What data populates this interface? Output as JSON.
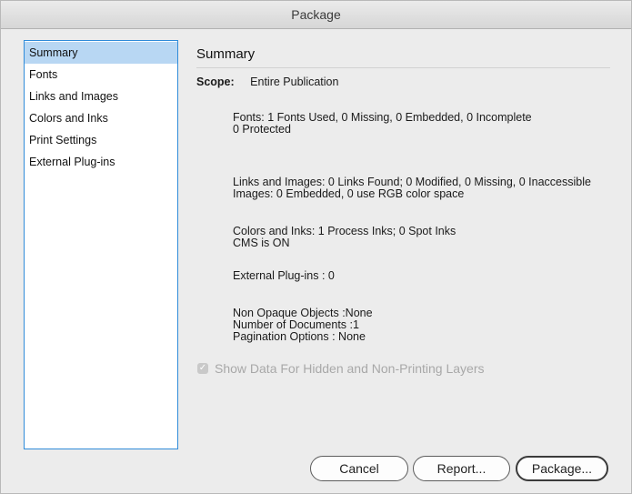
{
  "window": {
    "title": "Package"
  },
  "sidebar": {
    "items": [
      {
        "label": "Summary",
        "selected": true
      },
      {
        "label": "Fonts"
      },
      {
        "label": "Links and Images"
      },
      {
        "label": "Colors and Inks"
      },
      {
        "label": "Print Settings"
      },
      {
        "label": "External Plug-ins"
      }
    ]
  },
  "summary": {
    "title": "Summary",
    "scope_label": "Scope:",
    "scope_value": "Entire Publication",
    "fonts_line1": "Fonts: 1 Fonts Used, 0 Missing, 0 Embedded, 0 Incomplete",
    "fonts_line2": "0 Protected",
    "links_line1": "Links and Images: 0 Links Found; 0 Modified, 0 Missing, 0 Inaccessible",
    "links_line2": "Images: 0 Embedded, 0 use RGB color space",
    "colors_line1": "Colors and Inks: 1 Process Inks; 0 Spot Inks",
    "colors_line2": "CMS is ON",
    "plugins_line": "External Plug-ins : 0",
    "objects_line1": "Non Opaque Objects :None",
    "objects_line2": "Number of Documents :1",
    "objects_line3": "Pagination Options : None"
  },
  "options": {
    "show_hidden_label": "Show Data For Hidden and Non-Printing Layers",
    "show_hidden_checked": true,
    "show_hidden_enabled": false
  },
  "buttons": {
    "cancel": "Cancel",
    "report": "Report...",
    "package": "Package..."
  },
  "colors": {
    "selection": "#b8d7f3",
    "sidebar_border": "#2f8bd9"
  }
}
